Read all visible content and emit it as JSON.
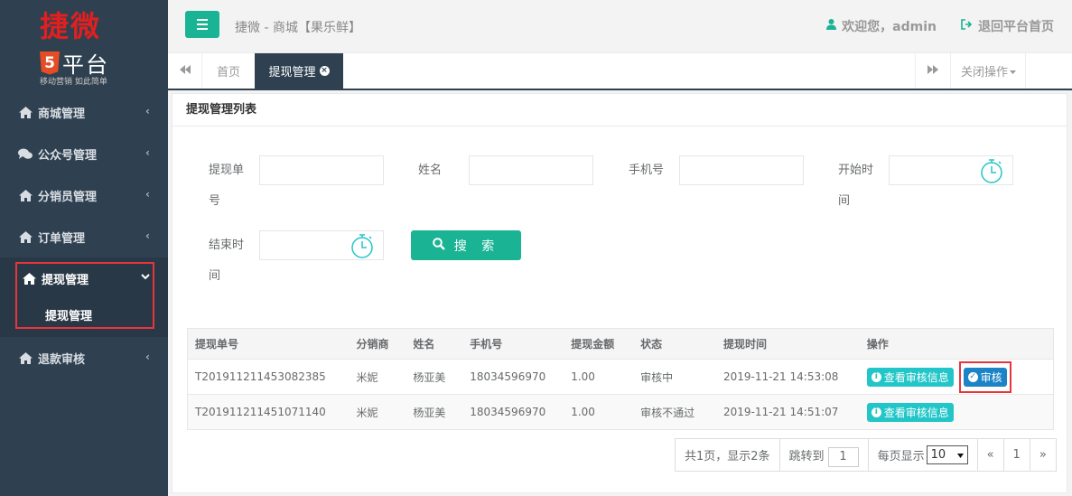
{
  "logo": {
    "brand": "捷微",
    "badge": "5",
    "platform": "平台",
    "slogan": "移动营销 如此简单"
  },
  "sidebar": {
    "items": [
      {
        "label": "商城管理",
        "icon": "home-icon"
      },
      {
        "label": "公众号管理",
        "icon": "comments-icon"
      },
      {
        "label": "分销员管理",
        "icon": "home-icon"
      },
      {
        "label": "订单管理",
        "icon": "home-icon"
      },
      {
        "label": "提现管理",
        "icon": "home-icon"
      },
      {
        "label": "退款审核",
        "icon": "home-icon"
      }
    ],
    "active_sub": "提现管理"
  },
  "header": {
    "title": "捷微 - 商城【果乐鲜】",
    "welcome": "欢迎您，admin",
    "back_home": "退回平台首页"
  },
  "tabs": {
    "home": "首页",
    "active": "提现管理",
    "close_ops": "关闭操作"
  },
  "panel": {
    "title": "提现管理列表"
  },
  "filters": {
    "order_no_a": "提现单",
    "order_no_b": "号",
    "name": "姓名",
    "phone": "手机号",
    "start_a": "开始时",
    "start_b": "间",
    "end_a": "结束时",
    "end_b": "间",
    "search": "搜 索"
  },
  "table": {
    "columns": [
      "提现单号",
      "分销商",
      "姓名",
      "手机号",
      "提现金额",
      "状态",
      "提现时间",
      "操作"
    ],
    "rows": [
      {
        "no": "T201911211453082385",
        "dist": "米妮",
        "name": "杨亚美",
        "phone": "18034596970",
        "amount": "1.00",
        "status": "审核中",
        "time": "2019-11-21 14:53:08",
        "view": "查看审核信息",
        "audit": "审核"
      },
      {
        "no": "T201911211451071140",
        "dist": "米妮",
        "name": "杨亚美",
        "phone": "18034596970",
        "amount": "1.00",
        "status": "审核不通过",
        "time": "2019-11-21 14:51:07",
        "view": "查看审核信息"
      }
    ]
  },
  "pager": {
    "summary": "共1页，显示2条",
    "jump_label": "跳转到",
    "jump_value": "1",
    "per_page_label": "每页显示",
    "per_page": "10",
    "prev": "«",
    "page": "1",
    "next": "»"
  },
  "colors": {
    "sidebar": "#2f4050",
    "accent": "#1ab394",
    "info": "#23c6c8",
    "primary": "#1c84c6",
    "highlight": "#e8353b"
  }
}
